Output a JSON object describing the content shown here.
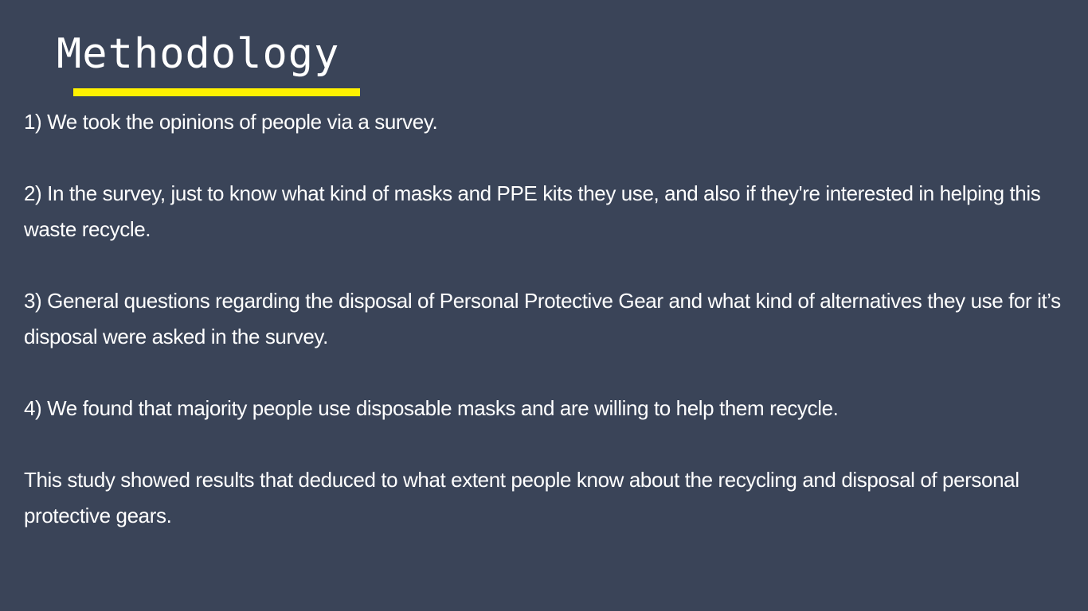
{
  "slide": {
    "title": "Methodology",
    "accent_color": "#fff200",
    "background_color": "#3a4458",
    "paragraphs": [
      "1) We took the opinions of people via a survey.",
      "2) In the survey, just to know what kind of masks and PPE kits they use, and also if they're interested in helping this waste recycle.",
      "3) General questions regarding the disposal of Personal Protective Gear and what kind of alternatives they use for it’s disposal were asked in the survey.",
      "4) We found that majority people use disposable masks and are willing to help them recycle.",
      "This study showed results that deduced to what extent people know about the recycling and disposal of personal protective gears."
    ]
  }
}
